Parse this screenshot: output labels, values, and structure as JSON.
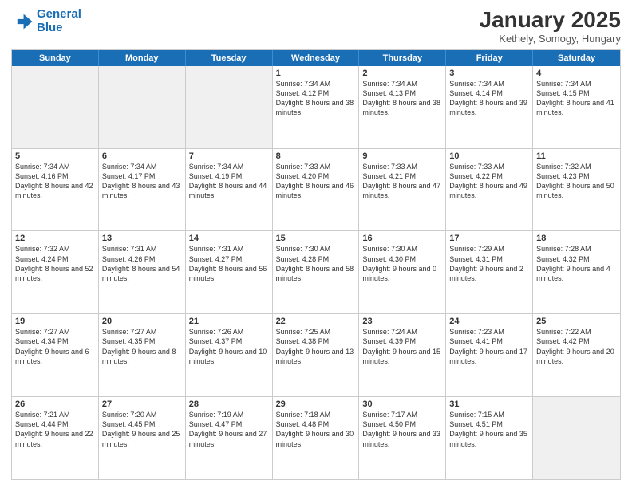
{
  "logo": {
    "line1": "General",
    "line2": "Blue"
  },
  "title": "January 2025",
  "subtitle": "Kethely, Somogy, Hungary",
  "dayHeaders": [
    "Sunday",
    "Monday",
    "Tuesday",
    "Wednesday",
    "Thursday",
    "Friday",
    "Saturday"
  ],
  "weeks": [
    [
      {
        "day": "",
        "info": "",
        "empty": true
      },
      {
        "day": "",
        "info": "",
        "empty": true
      },
      {
        "day": "",
        "info": "",
        "empty": true
      },
      {
        "day": "1",
        "info": "Sunrise: 7:34 AM\nSunset: 4:12 PM\nDaylight: 8 hours\nand 38 minutes."
      },
      {
        "day": "2",
        "info": "Sunrise: 7:34 AM\nSunset: 4:13 PM\nDaylight: 8 hours\nand 38 minutes."
      },
      {
        "day": "3",
        "info": "Sunrise: 7:34 AM\nSunset: 4:14 PM\nDaylight: 8 hours\nand 39 minutes."
      },
      {
        "day": "4",
        "info": "Sunrise: 7:34 AM\nSunset: 4:15 PM\nDaylight: 8 hours\nand 41 minutes."
      }
    ],
    [
      {
        "day": "5",
        "info": "Sunrise: 7:34 AM\nSunset: 4:16 PM\nDaylight: 8 hours\nand 42 minutes."
      },
      {
        "day": "6",
        "info": "Sunrise: 7:34 AM\nSunset: 4:17 PM\nDaylight: 8 hours\nand 43 minutes."
      },
      {
        "day": "7",
        "info": "Sunrise: 7:34 AM\nSunset: 4:19 PM\nDaylight: 8 hours\nand 44 minutes."
      },
      {
        "day": "8",
        "info": "Sunrise: 7:33 AM\nSunset: 4:20 PM\nDaylight: 8 hours\nand 46 minutes."
      },
      {
        "day": "9",
        "info": "Sunrise: 7:33 AM\nSunset: 4:21 PM\nDaylight: 8 hours\nand 47 minutes."
      },
      {
        "day": "10",
        "info": "Sunrise: 7:33 AM\nSunset: 4:22 PM\nDaylight: 8 hours\nand 49 minutes."
      },
      {
        "day": "11",
        "info": "Sunrise: 7:32 AM\nSunset: 4:23 PM\nDaylight: 8 hours\nand 50 minutes."
      }
    ],
    [
      {
        "day": "12",
        "info": "Sunrise: 7:32 AM\nSunset: 4:24 PM\nDaylight: 8 hours\nand 52 minutes."
      },
      {
        "day": "13",
        "info": "Sunrise: 7:31 AM\nSunset: 4:26 PM\nDaylight: 8 hours\nand 54 minutes."
      },
      {
        "day": "14",
        "info": "Sunrise: 7:31 AM\nSunset: 4:27 PM\nDaylight: 8 hours\nand 56 minutes."
      },
      {
        "day": "15",
        "info": "Sunrise: 7:30 AM\nSunset: 4:28 PM\nDaylight: 8 hours\nand 58 minutes."
      },
      {
        "day": "16",
        "info": "Sunrise: 7:30 AM\nSunset: 4:30 PM\nDaylight: 9 hours\nand 0 minutes."
      },
      {
        "day": "17",
        "info": "Sunrise: 7:29 AM\nSunset: 4:31 PM\nDaylight: 9 hours\nand 2 minutes."
      },
      {
        "day": "18",
        "info": "Sunrise: 7:28 AM\nSunset: 4:32 PM\nDaylight: 9 hours\nand 4 minutes."
      }
    ],
    [
      {
        "day": "19",
        "info": "Sunrise: 7:27 AM\nSunset: 4:34 PM\nDaylight: 9 hours\nand 6 minutes."
      },
      {
        "day": "20",
        "info": "Sunrise: 7:27 AM\nSunset: 4:35 PM\nDaylight: 9 hours\nand 8 minutes."
      },
      {
        "day": "21",
        "info": "Sunrise: 7:26 AM\nSunset: 4:37 PM\nDaylight: 9 hours\nand 10 minutes."
      },
      {
        "day": "22",
        "info": "Sunrise: 7:25 AM\nSunset: 4:38 PM\nDaylight: 9 hours\nand 13 minutes."
      },
      {
        "day": "23",
        "info": "Sunrise: 7:24 AM\nSunset: 4:39 PM\nDaylight: 9 hours\nand 15 minutes."
      },
      {
        "day": "24",
        "info": "Sunrise: 7:23 AM\nSunset: 4:41 PM\nDaylight: 9 hours\nand 17 minutes."
      },
      {
        "day": "25",
        "info": "Sunrise: 7:22 AM\nSunset: 4:42 PM\nDaylight: 9 hours\nand 20 minutes."
      }
    ],
    [
      {
        "day": "26",
        "info": "Sunrise: 7:21 AM\nSunset: 4:44 PM\nDaylight: 9 hours\nand 22 minutes."
      },
      {
        "day": "27",
        "info": "Sunrise: 7:20 AM\nSunset: 4:45 PM\nDaylight: 9 hours\nand 25 minutes."
      },
      {
        "day": "28",
        "info": "Sunrise: 7:19 AM\nSunset: 4:47 PM\nDaylight: 9 hours\nand 27 minutes."
      },
      {
        "day": "29",
        "info": "Sunrise: 7:18 AM\nSunset: 4:48 PM\nDaylight: 9 hours\nand 30 minutes."
      },
      {
        "day": "30",
        "info": "Sunrise: 7:17 AM\nSunset: 4:50 PM\nDaylight: 9 hours\nand 33 minutes."
      },
      {
        "day": "31",
        "info": "Sunrise: 7:15 AM\nSunset: 4:51 PM\nDaylight: 9 hours\nand 35 minutes."
      },
      {
        "day": "",
        "info": "",
        "empty": true
      }
    ]
  ]
}
